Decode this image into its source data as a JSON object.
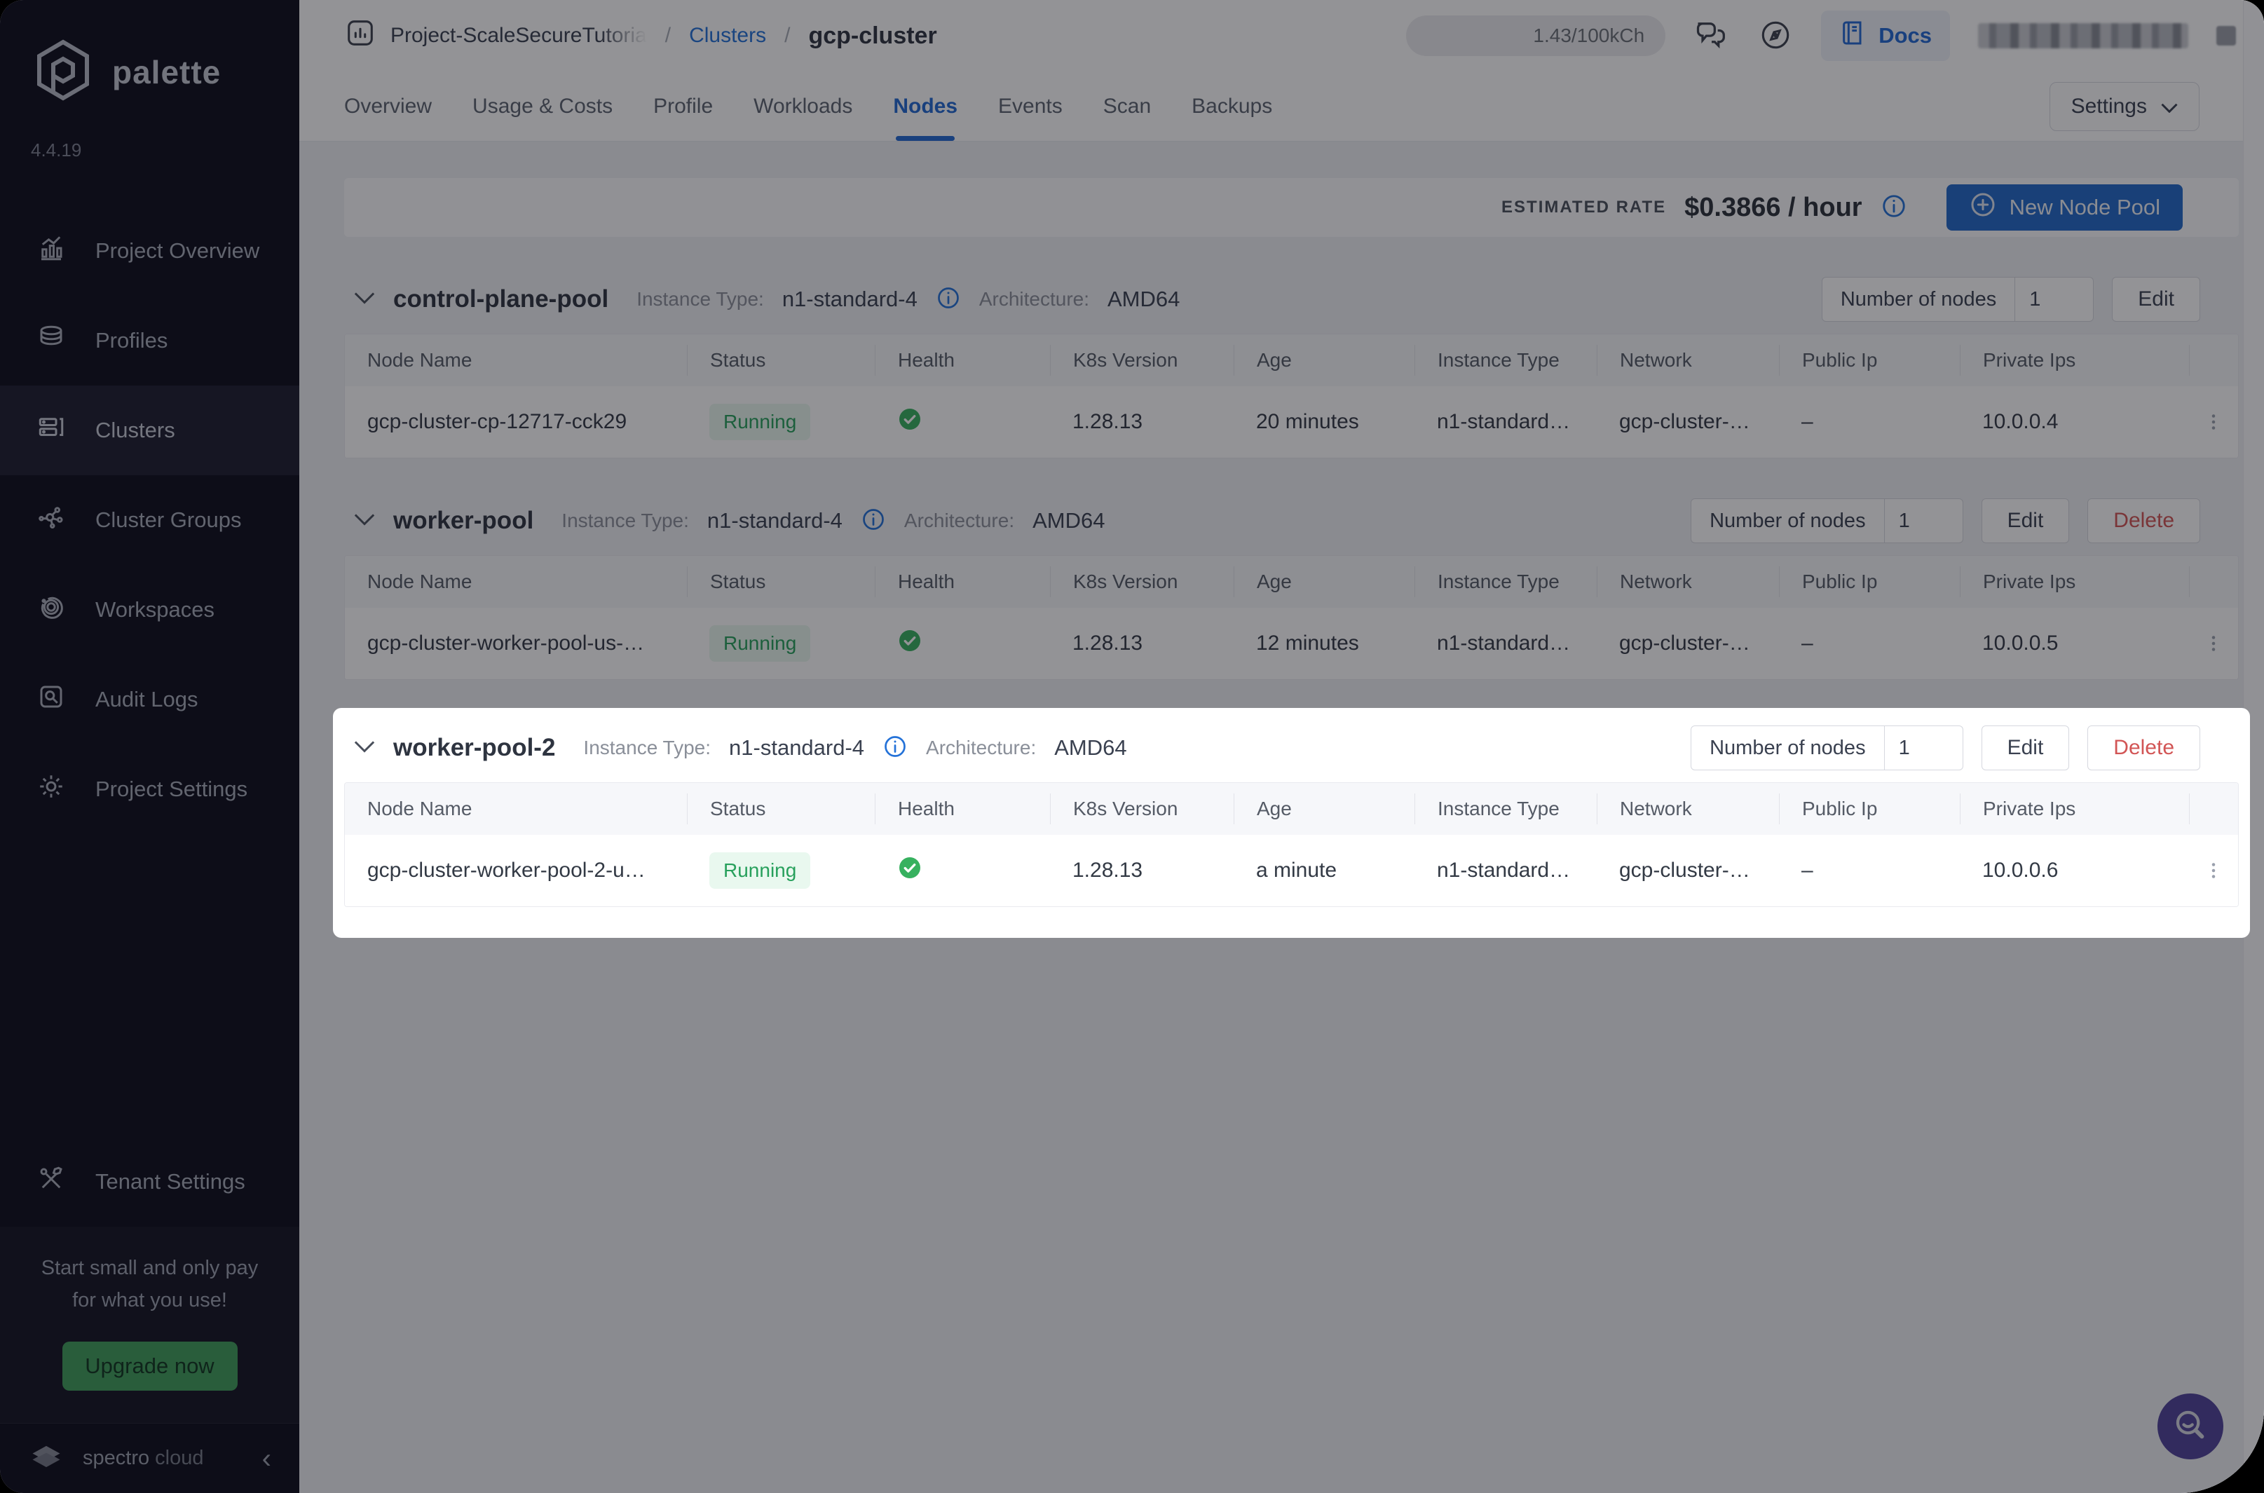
{
  "topbar": {
    "project": "Project-ScaleSecureTutoria",
    "sep1": "/",
    "clusters_link": "Clusters",
    "sep2": "/",
    "cluster_name": "gcp-cluster",
    "usage": "1.43/100kCh",
    "docs": "Docs"
  },
  "tabs": {
    "items": [
      "Overview",
      "Usage & Costs",
      "Profile",
      "Workloads",
      "Nodes",
      "Events",
      "Scan",
      "Backups"
    ],
    "active": "Nodes",
    "settings": "Settings"
  },
  "ratebar": {
    "label": "ESTIMATED RATE",
    "value": "$0.3866 / hour",
    "new_pool": "New Node Pool"
  },
  "table": {
    "headers": [
      "Node Name",
      "Status",
      "Health",
      "K8s Version",
      "Age",
      "Instance Type",
      "Network",
      "Public Ip",
      "Private Ips"
    ]
  },
  "pools": [
    {
      "name": "control-plane-pool",
      "instance_type_label": "Instance Type:",
      "instance_type": "n1-standard-4",
      "architecture_label": "Architecture:",
      "architecture": "AMD64",
      "nodes_label": "Number of nodes",
      "nodes_value": "1",
      "edit": "Edit",
      "row": {
        "name": "gcp-cluster-cp-12717-cck29",
        "status": "Running",
        "k8s_version": "1.28.13",
        "age": "20 minutes",
        "instance_type": "n1-standard…",
        "network": "gcp-cluster-…",
        "public_ip": "–",
        "private_ips": "10.0.0.4"
      }
    },
    {
      "name": "worker-pool",
      "instance_type_label": "Instance Type:",
      "instance_type": "n1-standard-4",
      "architecture_label": "Architecture:",
      "architecture": "AMD64",
      "nodes_label": "Number of nodes",
      "nodes_value": "1",
      "edit": "Edit",
      "delete": "Delete",
      "row": {
        "name": "gcp-cluster-worker-pool-us-…",
        "status": "Running",
        "k8s_version": "1.28.13",
        "age": "12 minutes",
        "instance_type": "n1-standard…",
        "network": "gcp-cluster-…",
        "public_ip": "–",
        "private_ips": "10.0.0.5"
      }
    },
    {
      "name": "worker-pool-2",
      "instance_type_label": "Instance Type:",
      "instance_type": "n1-standard-4",
      "architecture_label": "Architecture:",
      "architecture": "AMD64",
      "nodes_label": "Number of nodes",
      "nodes_value": "1",
      "edit": "Edit",
      "delete": "Delete",
      "row": {
        "name": "gcp-cluster-worker-pool-2-u…",
        "status": "Running",
        "k8s_version": "1.28.13",
        "age": "a minute",
        "instance_type": "n1-standard…",
        "network": "gcp-cluster-…",
        "public_ip": "–",
        "private_ips": "10.0.0.6"
      }
    }
  ],
  "sidebar": {
    "brand": "palette",
    "version": "4.4.19",
    "items": [
      {
        "label": "Project Overview"
      },
      {
        "label": "Profiles"
      },
      {
        "label": "Clusters"
      },
      {
        "label": "Cluster Groups"
      },
      {
        "label": "Workspaces"
      },
      {
        "label": "Audit Logs"
      },
      {
        "label": "Project Settings"
      }
    ],
    "tenant": "Tenant Settings",
    "promo_line1": "Start small and only pay",
    "promo_line2": "for what you use!",
    "upgrade": "Upgrade now",
    "footer_brand_1": "spectro",
    "footer_brand_2": "cloud"
  },
  "colors": {
    "accent_blue": "#2268c8",
    "running_green": "#27a05c",
    "danger_red": "#d25555",
    "upgrade_green": "#3f9d5a",
    "sidebar_bg": "#0c0c1b",
    "fab_purple": "#4f4399"
  }
}
